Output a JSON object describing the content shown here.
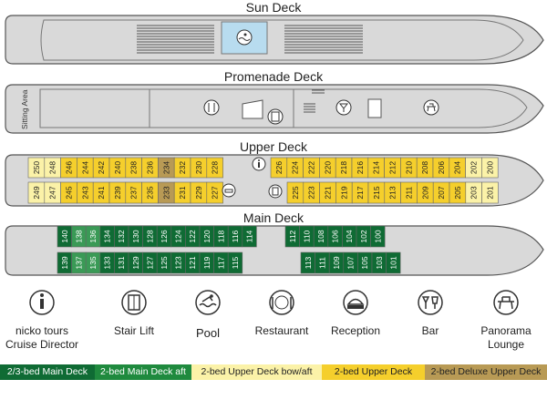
{
  "decks": {
    "sun": {
      "title": "Sun Deck"
    },
    "promenade": {
      "title": "Promenade Deck",
      "sitting_area": "Sitting Area"
    },
    "upper": {
      "title": "Upper Deck",
      "top_row": [
        "250",
        "248",
        "246",
        "244",
        "242",
        "240",
        "238",
        "236",
        "234",
        "232",
        "230",
        "228",
        "226",
        "224",
        "222",
        "220",
        "218",
        "216",
        "214",
        "212",
        "210",
        "208",
        "206",
        "204",
        "202",
        "200"
      ],
      "bottom_row": [
        "249",
        "247",
        "245",
        "243",
        "241",
        "239",
        "237",
        "235",
        "233",
        "231",
        "229",
        "227",
        "225",
        "223",
        "221",
        "219",
        "217",
        "215",
        "213",
        "211",
        "209",
        "207",
        "205",
        "203",
        "201"
      ]
    },
    "main": {
      "title": "Main Deck",
      "top_row": [
        "140",
        "138",
        "136",
        "134",
        "132",
        "130",
        "128",
        "126",
        "124",
        "122",
        "120",
        "118",
        "116",
        "114",
        "112",
        "110",
        "108",
        "106",
        "104",
        "102",
        "100"
      ],
      "bottom_row": [
        "139",
        "137",
        "135",
        "133",
        "131",
        "129",
        "127",
        "125",
        "123",
        "121",
        "119",
        "117",
        "115",
        "113",
        "111",
        "109",
        "107",
        "105",
        "103",
        "101"
      ]
    }
  },
  "icons": [
    {
      "name": "info-icon",
      "label": "nicko tours\nCruise Director"
    },
    {
      "name": "stair-lift-icon",
      "label": "Stair Lift"
    },
    {
      "name": "pool-icon",
      "label": "Pool"
    },
    {
      "name": "restaurant-icon",
      "label": "Restaurant"
    },
    {
      "name": "reception-icon",
      "label": "Reception"
    },
    {
      "name": "bar-icon",
      "label": "Bar"
    },
    {
      "name": "panorama-lounge-icon",
      "label": "Panorama\nLounge"
    }
  ],
  "legend": [
    {
      "label": "2/3-bed Main Deck",
      "color": "#0f6b34",
      "text_color": "#ffffff"
    },
    {
      "label": "2-bed Main Deck aft",
      "color": "#1f8a3e",
      "text_color": "#ffffff"
    },
    {
      "label": "2-bed Upper Deck bow/aft",
      "color": "#fbf2a8",
      "text_color": "#222222"
    },
    {
      "label": "2-bed Upper Deck",
      "color": "#f5cf2c",
      "text_color": "#222222"
    },
    {
      "label": "2-bed Deluxe Upper Deck",
      "color": "#b89a55",
      "text_color": "#222222"
    }
  ],
  "colors": {
    "hull": "#d9d9d9",
    "hull_stroke": "#555555",
    "main_deck": "#0f6b34",
    "main_deck_aft": "#3a9a56",
    "upper_standard": "#f5cf2c",
    "upper_bow_aft": "#fbf2a8",
    "deluxe": "#b89a55"
  }
}
